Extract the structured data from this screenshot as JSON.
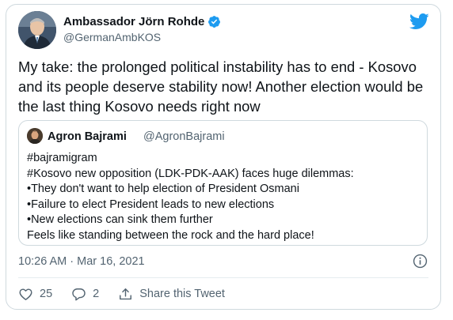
{
  "tweet": {
    "author": {
      "display_name": "Ambassador Jörn Rohde",
      "handle": "@GermanAmbKOS",
      "verified": true,
      "avatar_icon": "avatar-photo"
    },
    "text": "My take: the prolonged political instability has to end - Kosovo and its people deserve stability now! Another election would be the last thing Kosovo needs right now",
    "timestamp": "10:26 AM · Mar 16, 2021",
    "quoted": {
      "display_name": "Agron Bajrami",
      "handle": "@AgronBajrami",
      "lines": [
        "#bajramigram",
        "#Kosovo new opposition (LDK-PDK-AAK) faces huge dilemmas:",
        "•They don't want to help election of President Osmani",
        "•Failure to elect President leads to new elections",
        "•New elections can sink them further",
        "Feels like standing between the rock and the hard place!"
      ]
    },
    "actions": {
      "like_count": "25",
      "reply_count": "2",
      "share_label": "Share this Tweet"
    }
  },
  "colors": {
    "twitter_blue": "#1d9bf0",
    "text": "#0f1419",
    "secondary": "#536471",
    "border": "#cfd9de"
  },
  "icons": [
    "twitter-logo-icon",
    "verified-badge-icon",
    "info-icon",
    "heart-icon",
    "reply-icon",
    "share-icon"
  ]
}
